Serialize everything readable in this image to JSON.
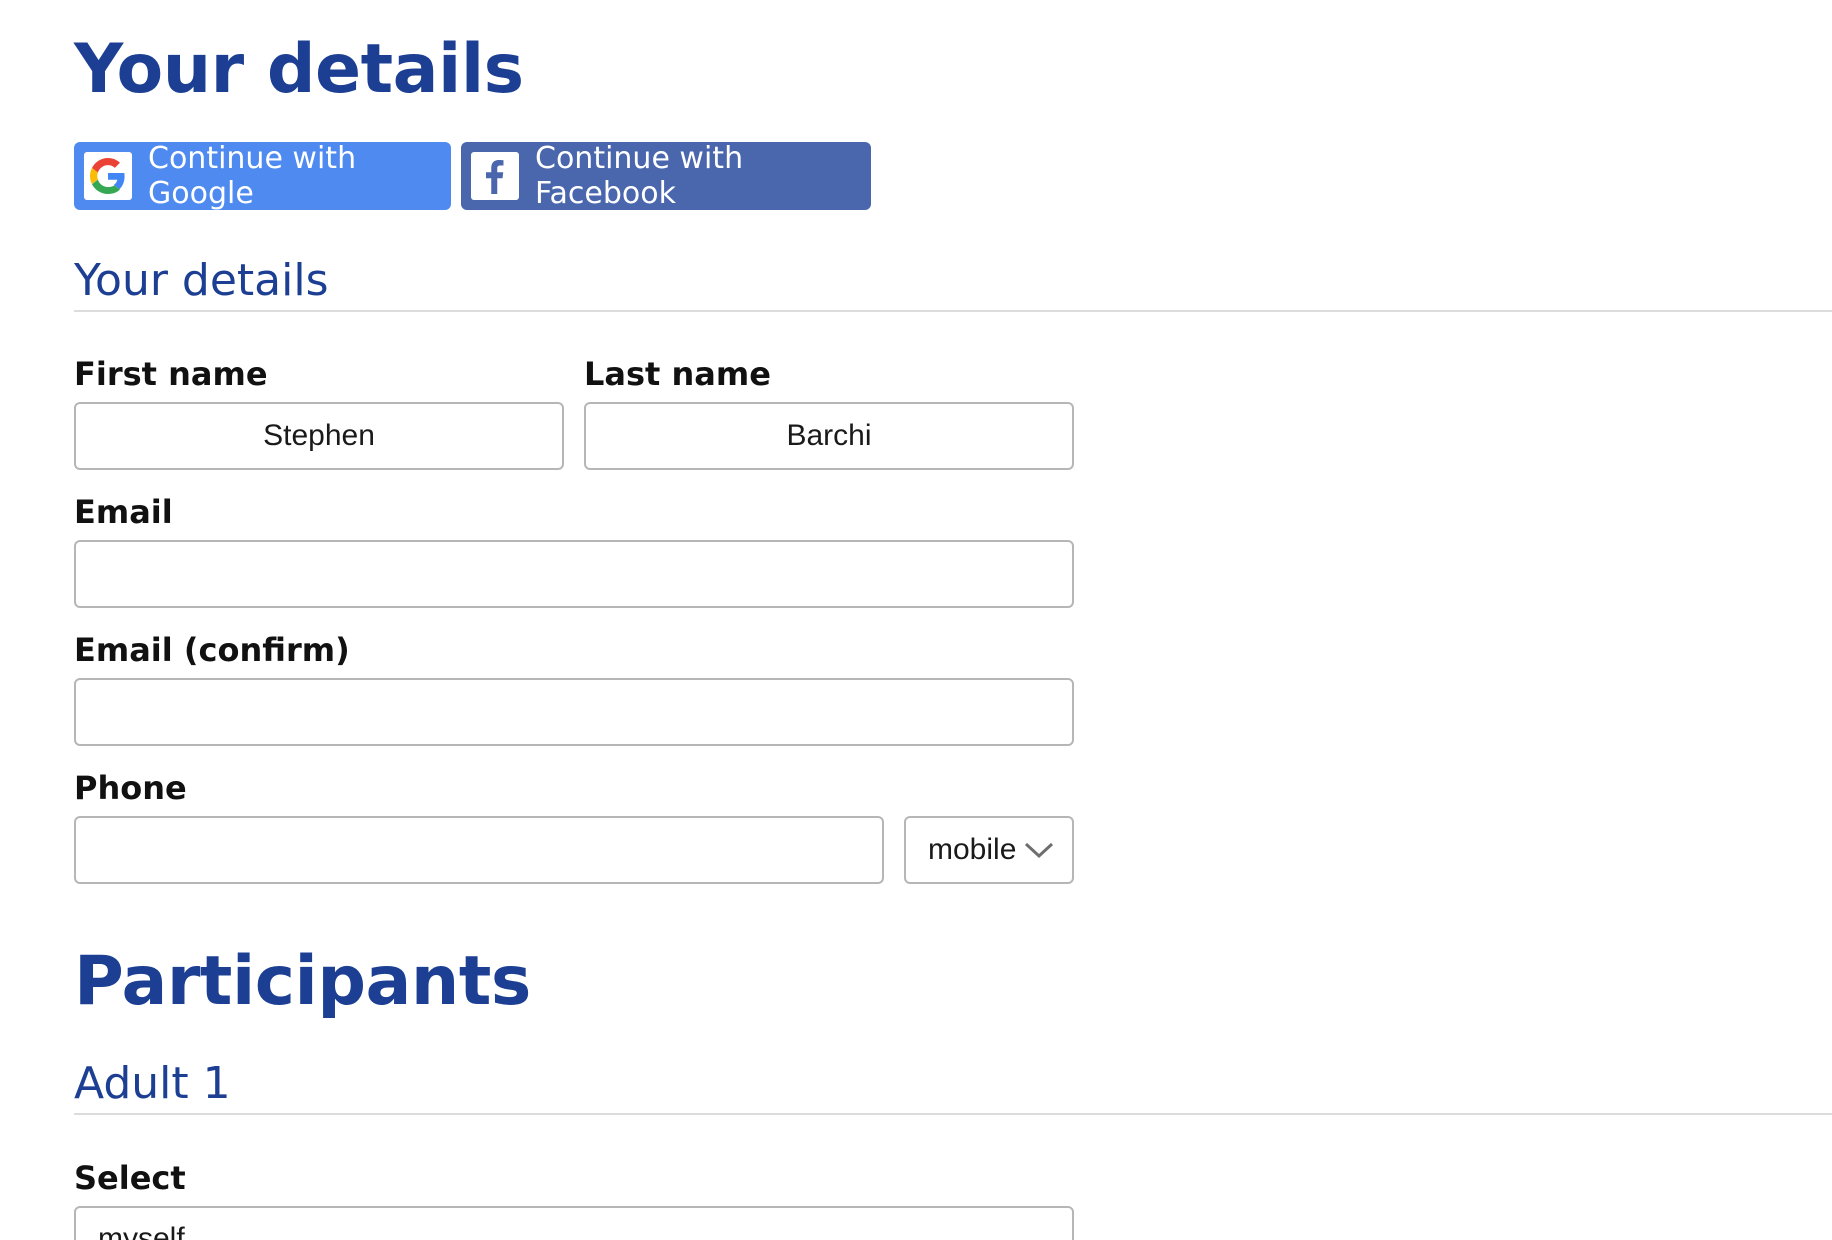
{
  "headings": {
    "main_title": "Your details",
    "details_subtitle": "Your details",
    "participants_title": "Participants",
    "adult_subtitle": "Adult 1"
  },
  "social": {
    "google_label": "Continue with Google",
    "facebook_label": "Continue with Facebook"
  },
  "form": {
    "first_name": {
      "label": "First name",
      "value": "Stephen"
    },
    "last_name": {
      "label": "Last name",
      "value": "Barchi"
    },
    "email": {
      "label": "Email",
      "value": ""
    },
    "email_confirm": {
      "label": "Email (confirm)",
      "value": ""
    },
    "phone": {
      "label": "Phone",
      "value": "",
      "type_selected": "mobile"
    }
  },
  "participants": {
    "adult1": {
      "select_label": "Select",
      "select_value": "myself"
    }
  },
  "colors": {
    "heading": "#1c3f94",
    "google_button": "#4e8af0",
    "facebook_button": "#4a66ad",
    "input_border": "#b6b6b6"
  },
  "icons": [
    "google-logo-icon",
    "facebook-logo-icon",
    "chevron-down-icon"
  ]
}
